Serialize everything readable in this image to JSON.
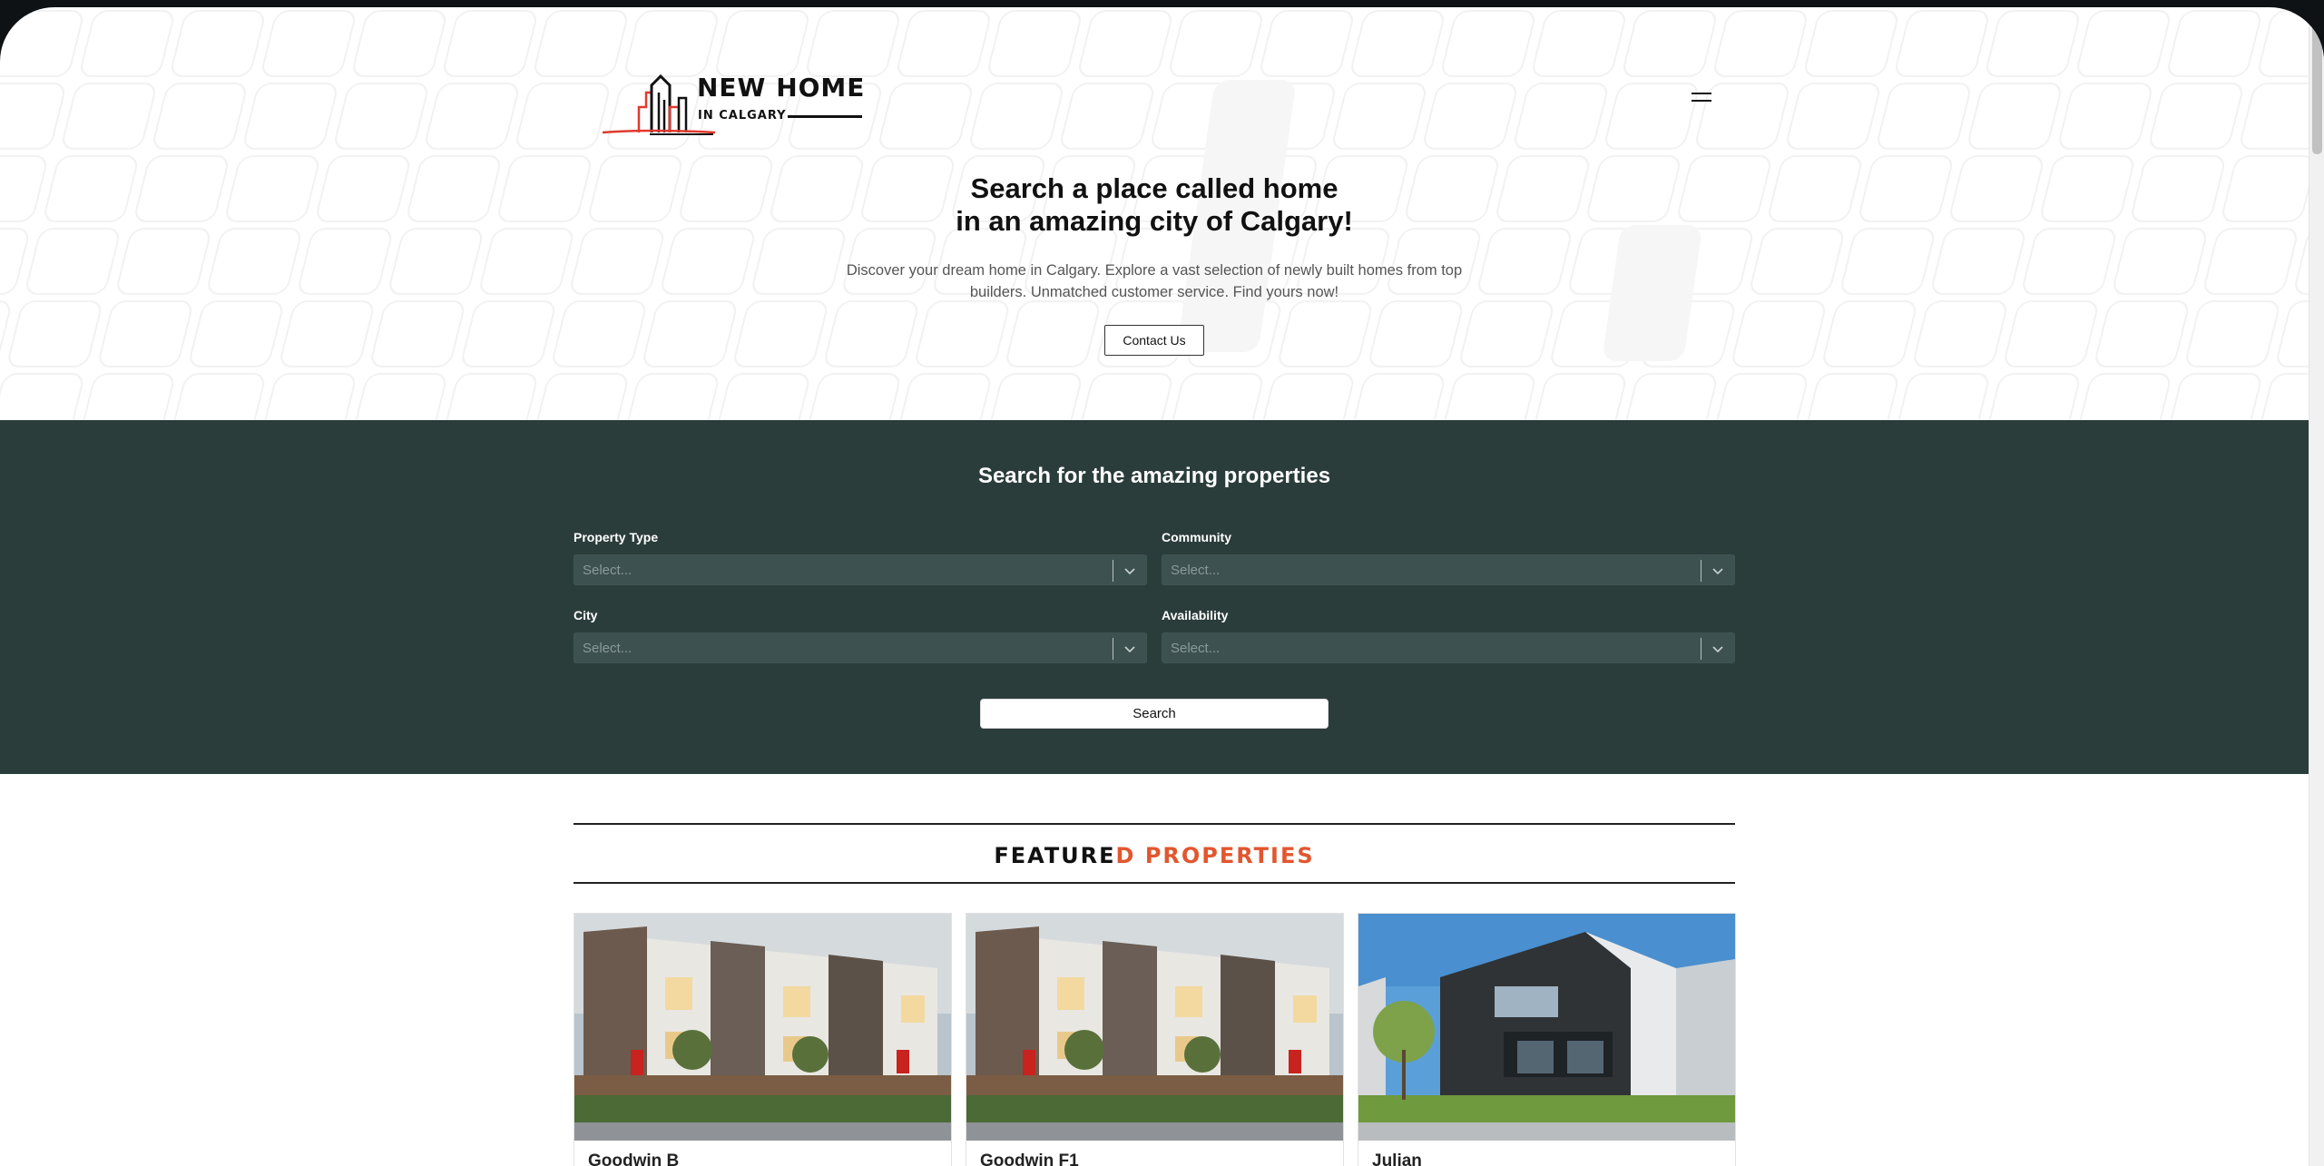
{
  "header": {
    "logo": {
      "line1": "NEW HOME",
      "line2": "IN CALGARY"
    },
    "menu_icon": "hamburger-menu-icon"
  },
  "hero": {
    "title_line1": "Search a place called home",
    "title_line2": "in an amazing city of Calgary!",
    "description_line1": "Discover your dream home in Calgary. Explore a vast selection of newly built homes from top",
    "description_line2": "builders. Unmatched customer service. Find yours now!",
    "contact_label": "Contact Us"
  },
  "search": {
    "title": "Search for the amazing properties",
    "fields": [
      {
        "label": "Property Type",
        "placeholder": "Select..."
      },
      {
        "label": "Community",
        "placeholder": "Select..."
      },
      {
        "label": "City",
        "placeholder": "Select..."
      },
      {
        "label": "Availability",
        "placeholder": "Select..."
      }
    ],
    "button_label": "Search"
  },
  "featured": {
    "title_part1": "FEATURE",
    "title_part2": "D PROPERTIES",
    "cards": [
      {
        "name": "Goodwin B"
      },
      {
        "name": "Goodwin F1"
      },
      {
        "name": "Julian"
      }
    ]
  },
  "colors": {
    "search_bg": "#2b3d3b",
    "accent": "#e2562f",
    "logo_red": "#e03a2e"
  }
}
